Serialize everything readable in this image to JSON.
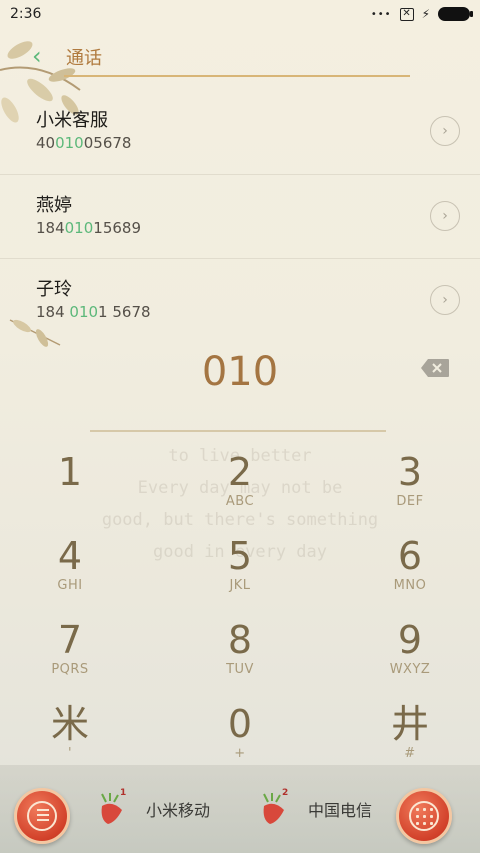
{
  "status_bar": {
    "time": "2:36",
    "dots": "•••"
  },
  "header": {
    "title": "通话"
  },
  "contacts": [
    {
      "name": "小米客服",
      "number_pre": "40",
      "number_match": "010",
      "number_post": "05678"
    },
    {
      "name": "燕婷",
      "number_pre": "184",
      "number_match": "010",
      "number_post": "15689"
    },
    {
      "name": "子玲",
      "number_pre": "184 ",
      "number_match": "010",
      "number_post": "1 5678"
    }
  ],
  "dialer": {
    "input_value": "010"
  },
  "watermark": [
    "to live better",
    "Every day may not be",
    "good, but there's something",
    "good in every day"
  ],
  "keypad": [
    {
      "digit": "1",
      "letters": ""
    },
    {
      "digit": "2",
      "letters": "ABC"
    },
    {
      "digit": "3",
      "letters": "DEF"
    },
    {
      "digit": "4",
      "letters": "GHI"
    },
    {
      "digit": "5",
      "letters": "JKL"
    },
    {
      "digit": "6",
      "letters": "MNO"
    },
    {
      "digit": "7",
      "letters": "PQRS"
    },
    {
      "digit": "8",
      "letters": "TUV"
    },
    {
      "digit": "9",
      "letters": "WXYZ"
    },
    {
      "digit": "米",
      "letters": "'"
    },
    {
      "digit": "0",
      "letters": "+"
    },
    {
      "digit": "井",
      "letters": "#"
    }
  ],
  "bottom_bar": {
    "sim1": {
      "slot": "1",
      "label": "小米移动"
    },
    "sim2": {
      "slot": "2",
      "label": "中国电信"
    }
  },
  "colors": {
    "accent_brown": "#a47542",
    "match_green": "#5cb87a",
    "button_red": "#d2412a"
  }
}
